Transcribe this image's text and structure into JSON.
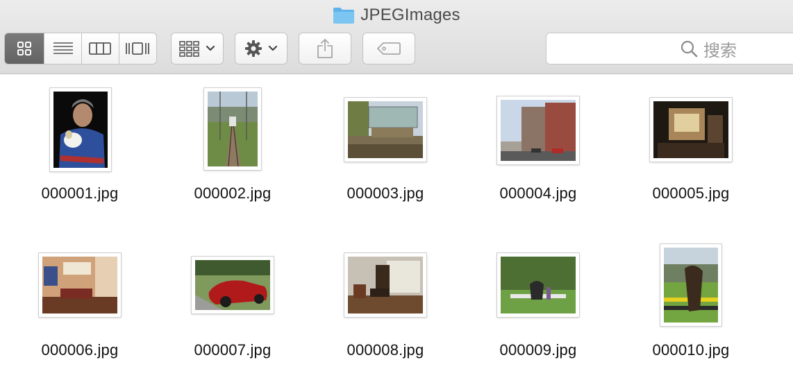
{
  "window": {
    "title": "JPEGImages",
    "title_icon": "folder-icon"
  },
  "toolbar": {
    "view_modes": [
      {
        "name": "icon-view",
        "icon": "grid-icon",
        "active": true
      },
      {
        "name": "list-view",
        "icon": "list-icon",
        "active": false
      },
      {
        "name": "column-view",
        "icon": "columns-icon",
        "active": false
      },
      {
        "name": "gallery-view",
        "icon": "gallery-icon",
        "active": false
      }
    ],
    "group_button_icon": "group-icon",
    "action_button_icon": "gear-icon",
    "share_button_icon": "share-icon",
    "tag_button_icon": "tag-icon",
    "search": {
      "placeholder": "搜索",
      "icon": "search-icon"
    }
  },
  "files": [
    {
      "name": "000001.jpg"
    },
    {
      "name": "000002.jpg"
    },
    {
      "name": "000003.jpg"
    },
    {
      "name": "000004.jpg"
    },
    {
      "name": "000005.jpg"
    },
    {
      "name": "000006.jpg"
    },
    {
      "name": "000007.jpg"
    },
    {
      "name": "000008.jpg"
    },
    {
      "name": "000009.jpg"
    },
    {
      "name": "000010.jpg"
    }
  ],
  "colors": {
    "accent_folder": "#5fb3ea",
    "active_segment": "#6b6b6b"
  }
}
